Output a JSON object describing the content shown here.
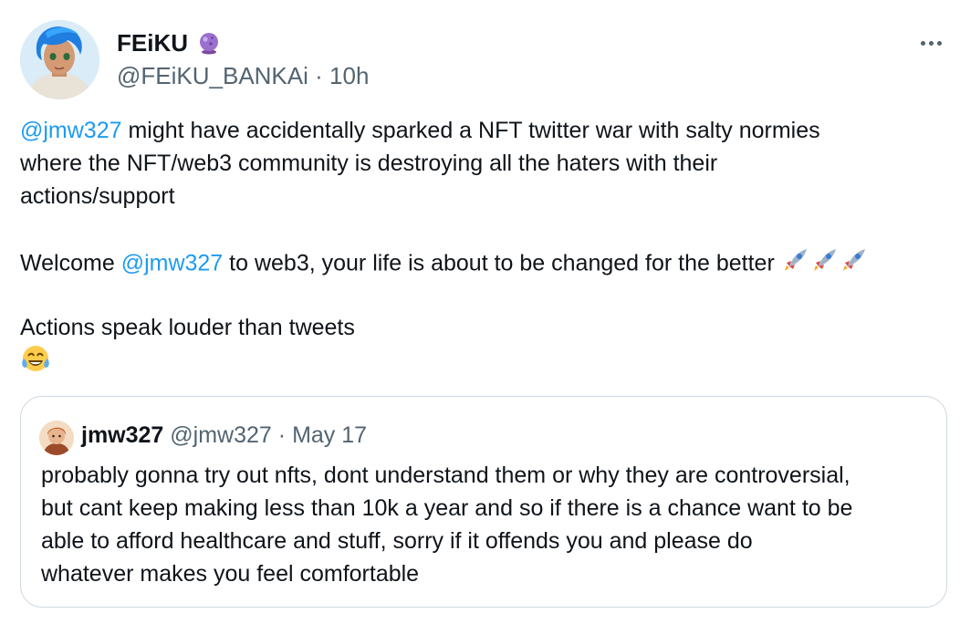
{
  "tweet": {
    "display_name": "FEiKU",
    "badge_icon": "crystal-ball-icon",
    "handle": "@FEiKU_BANKAi",
    "separator": "·",
    "time": "10h",
    "more_icon": "more-options-icon",
    "body": {
      "line1_mention": "@jmw327",
      "line1_rest": " might have accidentally sparked a NFT twitter war with salty normies",
      "line2": "where the NFT/web3 community is destroying all the haters with their",
      "line3": "actions/support",
      "line4_pre": "Welcome ",
      "line4_mention": "@jmw327",
      "line4_post": " to web3, your life is about to be changed for the better",
      "line4_emojis": [
        "rocket-emoji",
        "rocket-emoji",
        "rocket-emoji"
      ],
      "line5": "Actions speak louder than tweets",
      "line6_emoji": "tears-of-joy-emoji"
    }
  },
  "quote": {
    "display_name": "jmw327",
    "handle": "@jmw327",
    "separator": "·",
    "date": "May 17",
    "lines": [
      "probably gonna try out nfts, dont understand them or why they are controversial,",
      "but cant keep making less than 10k a year and so if there is a chance want to be",
      "able to afford healthcare and stuff, sorry if it offends you and please do",
      "whatever makes you feel comfortable"
    ]
  },
  "colors": {
    "link": "#1d9bf0",
    "secondary_text": "#536471",
    "border": "#cfd9de",
    "text": "#0f1419"
  }
}
